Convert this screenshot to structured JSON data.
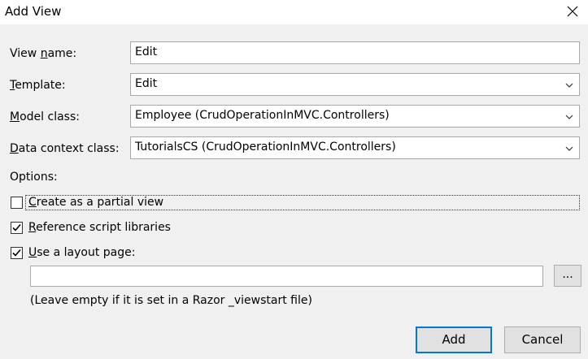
{
  "window": {
    "title": "Add View"
  },
  "form": {
    "view_name": {
      "label_pre": "View ",
      "label_key": "n",
      "label_post": "ame:",
      "value": "Edit"
    },
    "template": {
      "label_pre": "",
      "label_key": "T",
      "label_post": "emplate:",
      "value": "Edit"
    },
    "model_class": {
      "label_pre": "",
      "label_key": "M",
      "label_post": "odel class:",
      "value": "Employee (CrudOperationInMVC.Controllers)"
    },
    "data_context_class": {
      "label_pre": "",
      "label_key": "D",
      "label_post": "ata context class:",
      "value": "TutorialsCS (CrudOperationInMVC.Controllers)"
    }
  },
  "options": {
    "heading": "Options:",
    "partial_view": {
      "label_key": "C",
      "label_post": "reate as a partial view",
      "checked": false
    },
    "script_libraries": {
      "label_key": "R",
      "label_post": "eference script libraries",
      "checked": true
    },
    "layout_page": {
      "label_key": "U",
      "label_post": "se a layout page:",
      "checked": true
    },
    "layout_path": {
      "value": ""
    },
    "browse_label": "...",
    "hint": "(Leave empty if it is set in a Razor _viewstart file)"
  },
  "buttons": {
    "add": "Add",
    "cancel": "Cancel"
  }
}
